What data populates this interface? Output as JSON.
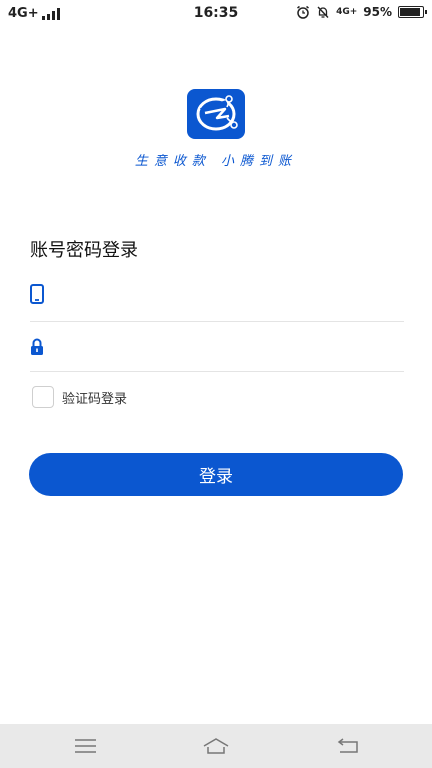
{
  "status_bar": {
    "network": "4G+",
    "time": "16:35",
    "network_secondary": "4G+",
    "battery": "95%",
    "battery_level": 0.95
  },
  "brand": {
    "slogan": "生意收款 小腾到账",
    "accent_color": "#0b57d0"
  },
  "login": {
    "title": "账号密码登录",
    "phone_field": {
      "value": "",
      "placeholder": ""
    },
    "password_field": {
      "value": "",
      "placeholder": ""
    },
    "sms_login_label": "验证码登录",
    "sms_login_checked": false,
    "submit_label": "登录"
  },
  "nav": {
    "icons": [
      "menu-icon",
      "home-icon",
      "back-icon"
    ]
  }
}
